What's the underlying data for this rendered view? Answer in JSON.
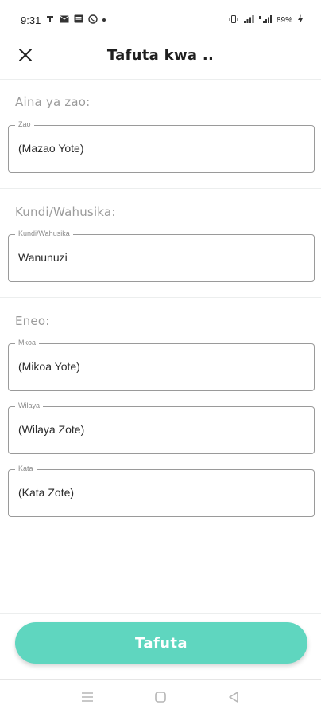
{
  "status_bar": {
    "time": "9:31",
    "battery": "89%",
    "left_icons": [
      "carrier-icon",
      "mail-icon",
      "message-icon",
      "whatsapp-icon"
    ],
    "right_icons": [
      "vibrate-icon",
      "signal-icon",
      "signal-lte-icon",
      "battery-icon"
    ]
  },
  "app_bar": {
    "title": "Tafuta kwa ..",
    "close_icon": "close-icon"
  },
  "sections": {
    "crop": {
      "label": "Aina ya zao:",
      "field_legend": "Zao",
      "field_value": "(Mazao Yote)"
    },
    "group": {
      "label": "Kundi/Wahusika:",
      "field_legend": "Kundi/Wahusika",
      "field_value": "Wanunuzi"
    },
    "area": {
      "label": "Eneo:",
      "region": {
        "legend": "Mkoa",
        "value": "(Mikoa Yote)"
      },
      "district": {
        "legend": "Wilaya",
        "value": "(Wilaya Zote)"
      },
      "ward": {
        "legend": "Kata",
        "value": "(Kata Zote)"
      }
    }
  },
  "search_button": {
    "label": "Tafuta"
  },
  "colors": {
    "accent": "#5fd6bf",
    "divider": "#eceeee",
    "label": "#9b9b9b"
  },
  "nav_bar": {
    "icons": [
      "recent-apps-icon",
      "home-icon",
      "back-icon"
    ]
  }
}
